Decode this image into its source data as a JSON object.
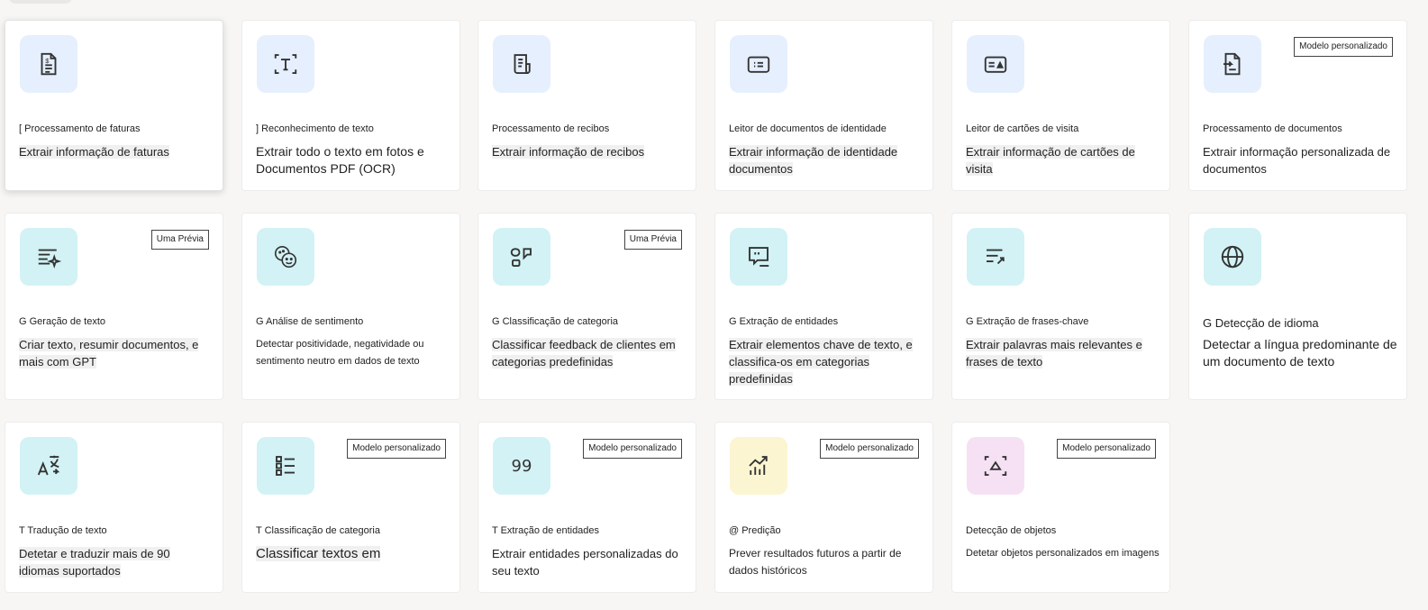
{
  "cards": [
    {
      "title": "[ Processamento de faturas",
      "description": "Extrair informação de faturas",
      "icon": "invoice-icon",
      "badge": ""
    },
    {
      "title": "] Reconhecimento de texto",
      "description": "Extrair todo o texto em fotos e Documentos PDF (OCR)",
      "icon": "text-recognition-icon",
      "badge": ""
    },
    {
      "title": "Processamento de recibos",
      "description": "Extrair informação de recibos",
      "icon": "receipt-icon",
      "badge": ""
    },
    {
      "title": "Leitor de documentos de identidade",
      "description": "Extrair informação de identidade documentos",
      "icon": "id-card-icon",
      "badge": ""
    },
    {
      "title": "Leitor de cartões de visita",
      "description": "Extrair informação de cartões de visita",
      "icon": "business-card-icon",
      "badge": ""
    },
    {
      "title": "Processamento de documentos",
      "description": "Extrair informação personalizada de documentos",
      "icon": "document-icon",
      "badge": "Modelo personalizado"
    },
    {
      "title": "G Geração de texto",
      "description": "Criar texto, resumir documentos, e mais com GPT",
      "icon": "sparkle-text-icon",
      "badge": "Uma Prévia"
    },
    {
      "title": "G Análise de sentimento",
      "description": "Detectar positividade, negatividade ou sentimento neutro em dados de texto",
      "icon": "emoji-icon",
      "badge": ""
    },
    {
      "title": "G Classificação de categoria",
      "description": "Classificar feedback de clientes em categorias predefinidas",
      "icon": "category-chat-icon",
      "badge": "Uma Prévia"
    },
    {
      "title": "G Extração de entidades",
      "description": "Extrair elementos chave de texto, e classifica-os em categorias predefinidas",
      "icon": "entity-extraction-icon",
      "badge": ""
    },
    {
      "title": "G Extração de frases-chave",
      "description": "Extrair palavras mais relevantes e frases de texto",
      "icon": "key-phrase-icon",
      "badge": ""
    },
    {
      "title": "G Detecção de idioma",
      "description": "Detectar a língua predominante de um documento de texto",
      "icon": "globe-icon",
      "badge": ""
    },
    {
      "title": "T Tradução de texto",
      "description": "Detetar e traduzir mais de 90 idiomas suportados",
      "icon": "translate-icon",
      "badge": ""
    },
    {
      "title": "T Classificação de categoria",
      "description": "Classificar textos em",
      "icon": "list-icon",
      "badge": "Modelo personalizado"
    },
    {
      "title": "T Extração de entidades",
      "description": "Extrair entidades personalizadas do seu texto",
      "icon": "quote-99-icon",
      "badge": "Modelo personalizado"
    },
    {
      "title": "@ Predição",
      "description": "Prever resultados futuros a partir de dados históricos",
      "icon": "chart-icon",
      "badge": "Modelo personalizado"
    },
    {
      "title": "Detecção de objetos",
      "description": "Detetar objetos personalizados em imagens",
      "icon": "object-detection-icon",
      "badge": "Modelo personalizado"
    }
  ],
  "icon_glyphs": {
    "quote-99-icon": "99"
  },
  "colors": {
    "tile_blue": "#e6effd",
    "tile_cyan": "#d2f2f5",
    "tile_yellow": "#fcf5d2",
    "tile_pink": "#f6e1f4"
  }
}
